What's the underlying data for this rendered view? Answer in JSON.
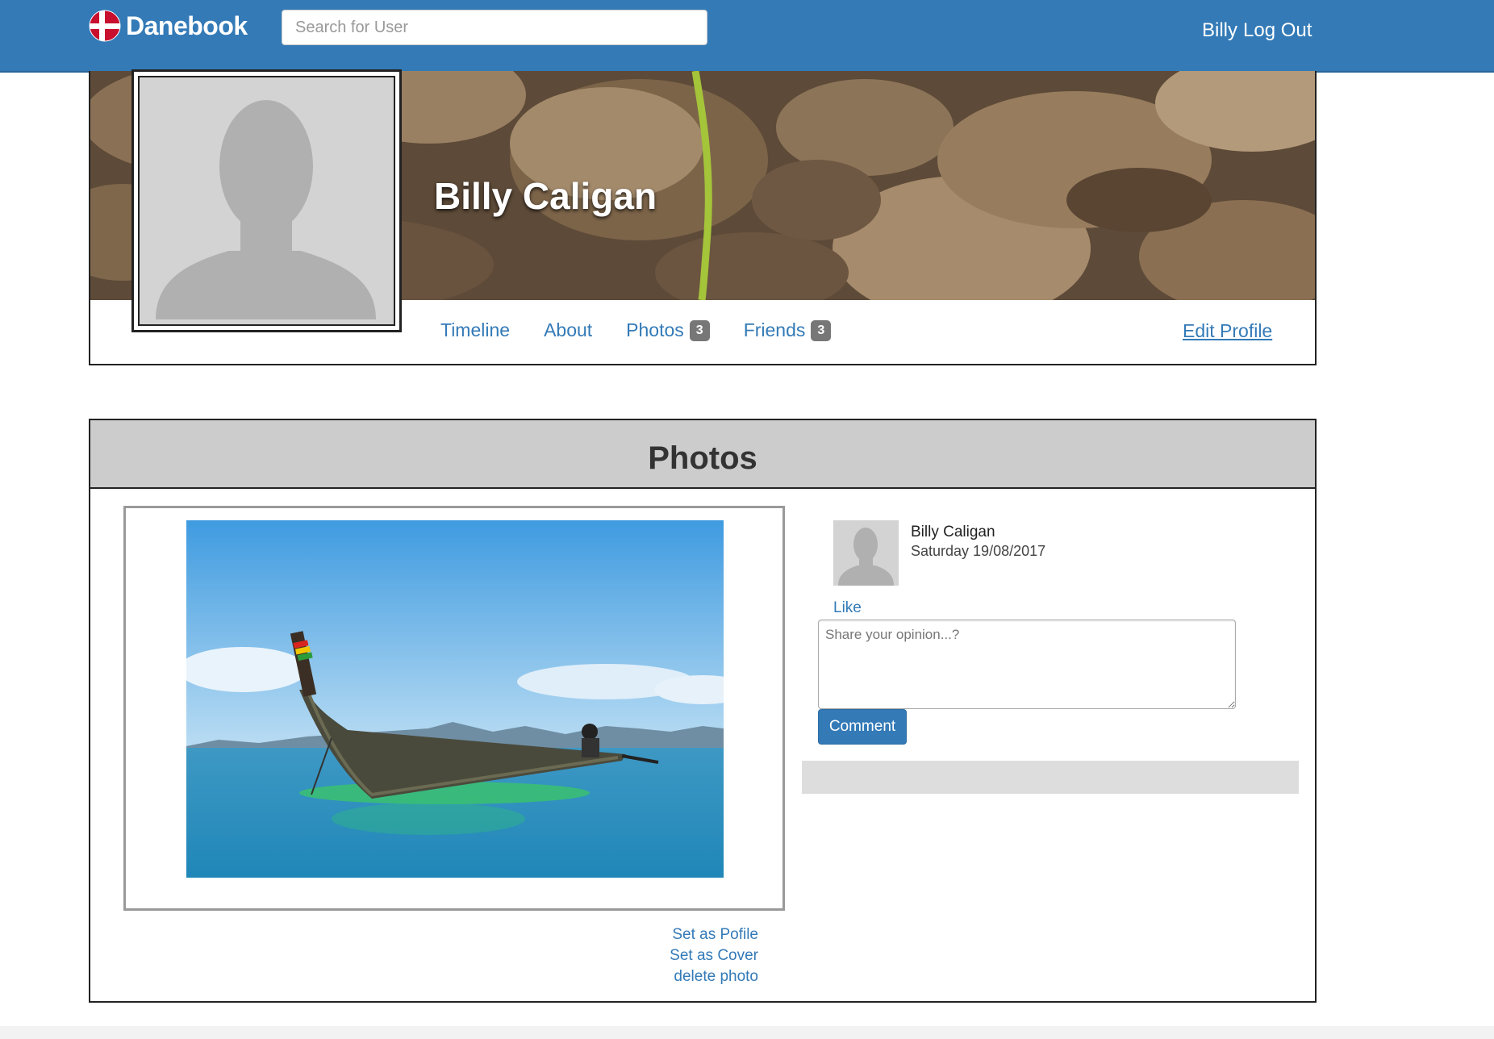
{
  "navbar": {
    "brand": "Danebook",
    "search_placeholder": "Search for User",
    "user_name": "Billy",
    "logout_label": "Log Out",
    "color": "#337ab7"
  },
  "profile": {
    "name": "Billy Caligan",
    "tabs": [
      {
        "label": "Timeline",
        "badge": null
      },
      {
        "label": "About",
        "badge": null
      },
      {
        "label": "Photos",
        "badge": "3"
      },
      {
        "label": "Friends",
        "badge": "3"
      }
    ],
    "edit_label": "Edit Profile"
  },
  "photos": {
    "title": "Photos",
    "actions": {
      "set_profile": "Set as Pofile",
      "set_cover": "Set as Cover",
      "delete": "delete photo"
    },
    "post": {
      "author": "Billy Caligan",
      "date": "Saturday 19/08/2017",
      "like_label": "Like",
      "comment_placeholder": "Share your opinion...?",
      "comment_button": "Comment"
    }
  }
}
